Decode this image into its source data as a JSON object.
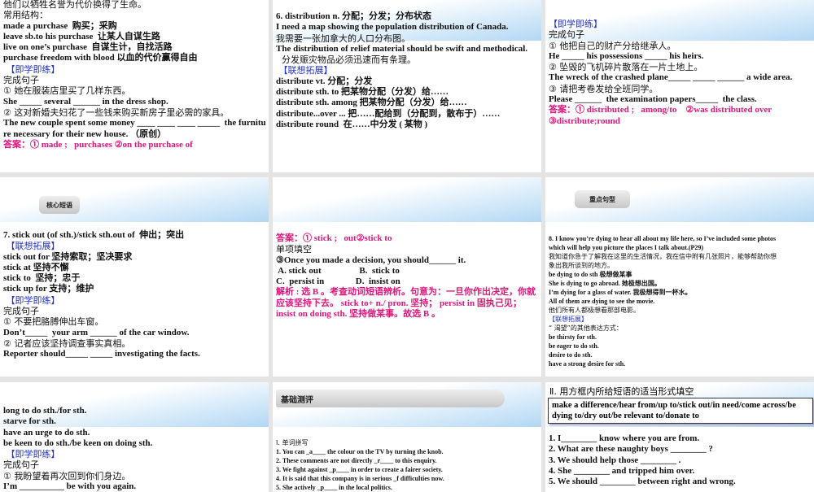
{
  "panels": [
    {
      "lines": [
        {
          "t": "他们以牺牲名誉为代价换得了生命。",
          "c": "n"
        },
        {
          "t": "常用结构：",
          "c": "n"
        },
        {
          "t": "made a purchase  购买；采购",
          "c": "b"
        },
        {
          "t": "leave sb.to his purchase  让某人自谋生路",
          "c": "b"
        },
        {
          "t": "live on one’s purchase  自谋生计，自找活路",
          "c": "b"
        },
        {
          "t": "purchase freedom with blood 以血的代价赢得自由",
          "c": "b"
        },
        {
          "t": " 【即学即练】",
          "c": "blue"
        },
        {
          "t": "完成句子",
          "c": "n"
        },
        {
          "t": "① 她在服装店里买了几样东西。",
          "c": "n"
        },
        {
          "t": "She _____ several ______ in the dress shop.",
          "c": "b"
        },
        {
          "t": "② 这对新婚夫妇花了一些钱来购买新房子里必需的家具。",
          "c": "n"
        },
        {
          "t": "The new couple spent some money ____ ____ ____ _____  the furnitu",
          "c": "b"
        },
        {
          "t": "re necessary for their new house. （原创）",
          "c": "b"
        },
        {
          "t": "答案：① made ;   purchases ②on the purchase of",
          "c": "pink"
        }
      ]
    },
    {
      "lines": [
        {
          "t": "6. distribution n. 分配；分发；分布状态",
          "c": "b"
        },
        {
          "t": "I need a map showing the population distribution of Canada.",
          "c": "b"
        },
        {
          "t": "我需要一张加拿大的人口分布图。",
          "c": "n"
        },
        {
          "t": "The distribution of relief material should be swift and methodical.",
          "c": "b"
        },
        {
          "t": "  分发赈灾物品必须迅速而有条理。",
          "c": "n"
        },
        {
          "t": " 【联想拓展】",
          "c": "blue"
        },
        {
          "t": "distribute vt. 分配；分发",
          "c": "b"
        },
        {
          "t": "distribute sth. to 把某物分配（分发）给……",
          "c": "b"
        },
        {
          "t": "distribute sth. among 把某物分配（分发）给……",
          "c": "b"
        },
        {
          "t": "distribute...over ... 把……配给到（分配到，散布于）……",
          "c": "b"
        },
        {
          "t": "distribute round  在……中分发 ( 某物 )",
          "c": "b"
        }
      ]
    },
    {
      "lines": [
        {
          "t": "【即学即练】",
          "c": "blue"
        },
        {
          "t": "完成句子",
          "c": "n"
        },
        {
          "t": "① 他把自己的财产分给继承人。",
          "c": "n"
        },
        {
          "t": "He _____ his possessions _____ his heirs.",
          "c": "b"
        },
        {
          "t": "② 坠毁的飞机碎片散落在一片土地上。",
          "c": "n"
        },
        {
          "t": "The wreck of the crashed plane_____ _____ ______ a wide area.",
          "c": "b"
        },
        {
          "t": "③ 请把考卷发给全班同学。",
          "c": "n"
        },
        {
          "t": "Please ______  the examination papers_____  the class.",
          "c": "b"
        },
        {
          "t": "答案：① distributed ;   among/to    ②was distributed over",
          "c": "pink"
        },
        {
          "t": "③distribute;round",
          "c": "pink"
        }
      ]
    },
    {
      "banner": "核心短语",
      "lines": [
        {
          "t": "7. stick out (of sth.)/stick sth.out of  伸出；突出",
          "c": "b"
        },
        {
          "t": " 【联想拓展】",
          "c": "blue"
        },
        {
          "t": "stick out for 坚持索取；坚决要求",
          "c": "b"
        },
        {
          "t": "stick at 坚持不懈",
          "c": "b"
        },
        {
          "t": "stick to  坚持；忠于",
          "c": "b"
        },
        {
          "t": "stick up for 支持；维护",
          "c": "b"
        },
        {
          "t": " 【即学即练】",
          "c": "blue"
        },
        {
          "t": "完成句子",
          "c": "n"
        },
        {
          "t": "① 不要把胳膊伸出车窗。",
          "c": "n"
        },
        {
          "t": "Don’t_____  your arm ______ of the car window.",
          "c": "b"
        },
        {
          "t": "② 记者应该坚持调查事实真相。",
          "c": "n"
        },
        {
          "t": "Reporter should_____ _____ investigating the facts.",
          "c": "b"
        }
      ]
    },
    {
      "lines": [
        {
          "t": "答案：① stick ;   out②stick to",
          "c": "pink"
        },
        {
          "t": "单项填空",
          "c": "n"
        },
        {
          "t": "③Once you made a decision, you should______ it.",
          "c": "b"
        },
        {
          "t": " A. stick out                 B.  stick to",
          "c": "b"
        },
        {
          "t": "C.  persist in              D.  insist on",
          "c": "b"
        },
        {
          "t": "解析 : 选 B 。考查动词短语辨析。句意为：一旦你作出决定，你就应该坚持下去。 stick to+ n./ pron. 坚持； persist in  固执己见； insist on doing sth. 坚持做某事。故选 B 。",
          "c": "pink wrap"
        }
      ]
    },
    {
      "banner": "重点句型",
      "lines": [
        {
          "t": "8. I know you’re dying to hear all about my life here, so I’ve included some photos",
          "c": "b"
        },
        {
          "t": "which will help you picture the places I talk about.(P29)",
          "c": "b"
        },
        {
          "t": "我知道你急于了解我在这里的生活情况，我在信中附有几张照片，能够帮助你想",
          "c": "n"
        },
        {
          "t": "象出我所谈到的地方。",
          "c": "n"
        },
        {
          "t": "be dying to do sth 极想做某事",
          "c": "b"
        },
        {
          "t": "She is dying to go abroad. 她极想出国。",
          "c": "b"
        },
        {
          "t": "I’m dying for a glass of water. 我极想得到一杯水。",
          "c": "b"
        },
        {
          "t": "All of them are dying to see the movie.",
          "c": "b"
        },
        {
          "t": "他们所有人都极想看那部电影。",
          "c": "n"
        },
        {
          "t": "【联想拓展】",
          "c": "blue"
        },
        {
          "t": "“ 渴望”的其他表达方式：",
          "c": "n"
        },
        {
          "t": "be thirsty for sth.",
          "c": "b"
        },
        {
          "t": "be eager to do sth.",
          "c": "b"
        },
        {
          "t": "desire to do sth.",
          "c": "b"
        },
        {
          "t": "have a strong desire for sth.",
          "c": "b"
        }
      ]
    },
    {
      "lines": [
        {
          "t": "long to do sth./for sth.",
          "c": "b"
        },
        {
          "t": "starve for sth.",
          "c": "b"
        },
        {
          "t": "have an urge to do sth.",
          "c": "b"
        },
        {
          "t": "be keen to do sth./be keen on doing sth.",
          "c": "b"
        },
        {
          "t": " 【即学即练】",
          "c": "blue"
        },
        {
          "t": "完成句子",
          "c": "n"
        },
        {
          "t": "① 我盼望着再次回到你们身边。",
          "c": "n"
        },
        {
          "t": "I’m __________ be with you again.",
          "c": "b"
        }
      ]
    },
    {
      "banner": "基础测评",
      "lines": [
        {
          "t": "Ⅰ. 单词拼写",
          "c": "n"
        },
        {
          "t": "1. You can _a____ the colour on the TV by turning the knob.",
          "c": "b"
        },
        {
          "t": "2. These comments are not directly _r____ to this enquiry.",
          "c": "b"
        },
        {
          "t": "3. We fight against _p____ in order to create a fairer society.",
          "c": "b"
        },
        {
          "t": "4. It is said that this company is in serious _f difficulties now.",
          "c": "b"
        },
        {
          "t": "5. She actively _p____ in the local politics.",
          "c": "b"
        }
      ]
    },
    {
      "heading": "Ⅱ.  用方框内所给短语的适当形式填空",
      "box": "make a difference/hear from/up to/stick out/in need/come across/be dying to/dry out/be relevant to/donate to",
      "lines": [
        {
          "t": "1. I________ know where you are from.",
          "c": "b"
        },
        {
          "t": "2. What are these naughty boys ________ ?",
          "c": "b"
        },
        {
          "t": "3. We should help those ________ .",
          "c": "b"
        },
        {
          "t": "4. She ________ and tripped him over.",
          "c": "b"
        },
        {
          "t": "5. We should ________ between right and wrong.",
          "c": "b"
        }
      ]
    }
  ]
}
